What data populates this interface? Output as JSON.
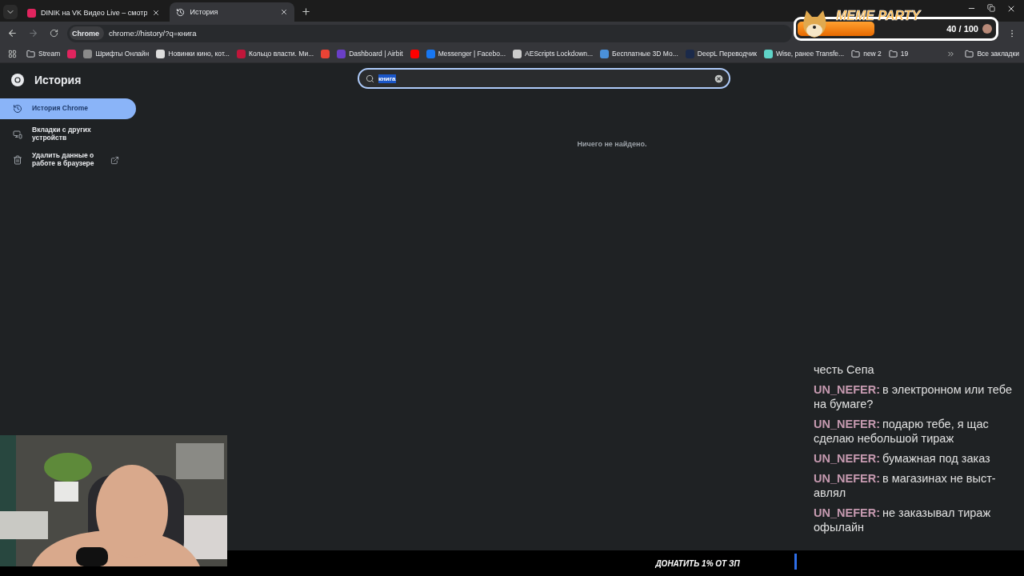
{
  "tabs": [
    {
      "title": "DINIK на VK Видео Live – смотр",
      "selected": false,
      "kind": "live"
    },
    {
      "title": "История",
      "selected": true,
      "kind": "history"
    }
  ],
  "address": {
    "chip": "Chrome",
    "url": "chrome://history/?q=книга"
  },
  "bookmarks": [
    {
      "kind": "folder",
      "label": "Stream"
    },
    {
      "kind": "site",
      "color": "#e0245e"
    },
    {
      "kind": "site",
      "color": "#8a8a8a",
      "label": "Шрифты Онлайн"
    },
    {
      "kind": "site",
      "color": "#dddddd",
      "label": "Новинки кино, кот..."
    },
    {
      "kind": "site",
      "color": "#c0163a",
      "label": "Кольцо власти. Ми..."
    },
    {
      "kind": "site",
      "color": "#ea4335"
    },
    {
      "kind": "site",
      "color": "#6a3fc8",
      "label": "Dashboard | Airbit"
    },
    {
      "kind": "site",
      "color": "#ff0000"
    },
    {
      "kind": "site",
      "color": "#1877f2",
      "label": "Messenger | Facebo..."
    },
    {
      "kind": "site",
      "color": "#cccccc",
      "label": "AEScripts Lockdown..."
    },
    {
      "kind": "site",
      "color": "#4a90d9",
      "label": "Бесплатные 3D Мо..."
    },
    {
      "kind": "site",
      "color": "#1b2a4a",
      "label": "DeepL Переводчик"
    },
    {
      "kind": "site",
      "color": "#5fd4c8",
      "label": "Wise, ранее Transfe..."
    },
    {
      "kind": "folder",
      "label": "new 2"
    },
    {
      "kind": "folder",
      "label": "19"
    }
  ],
  "all_bookmarks": "Все закладки",
  "page": {
    "title": "История",
    "nav": [
      {
        "label": "История Chrome",
        "kind": "history",
        "selected": true
      },
      {
        "label": "Вкладки с других устройств",
        "kind": "devices",
        "selected": false
      },
      {
        "label": "Удалить данные о работе в браузере",
        "kind": "delete",
        "selected": false
      }
    ],
    "search": {
      "value": "книга"
    },
    "empty": "Ничего не найдено."
  },
  "meme_party": {
    "title": "MEME PARTY",
    "count": "40 / 100",
    "level": 0.4
  },
  "chat": [
    {
      "text": "честь Сепа"
    },
    {
      "author": "UN_NEFER:",
      "text": "в электронном или тебе на бумаге?"
    },
    {
      "author": "UN_NEFER:",
      "text": "подарю тебе, я щас сделаю небольшой тираж"
    },
    {
      "author": "UN_NEFER:",
      "text": "бумажная под заказ"
    },
    {
      "author": "UN_NEFER:",
      "text": "в магазинах не выст-авлял"
    },
    {
      "author": "UN_NEFER:",
      "text": "не заказывал тираж офылайн"
    }
  ],
  "donate": "ДОНАТИТЬ 1% ОТ ЗП"
}
